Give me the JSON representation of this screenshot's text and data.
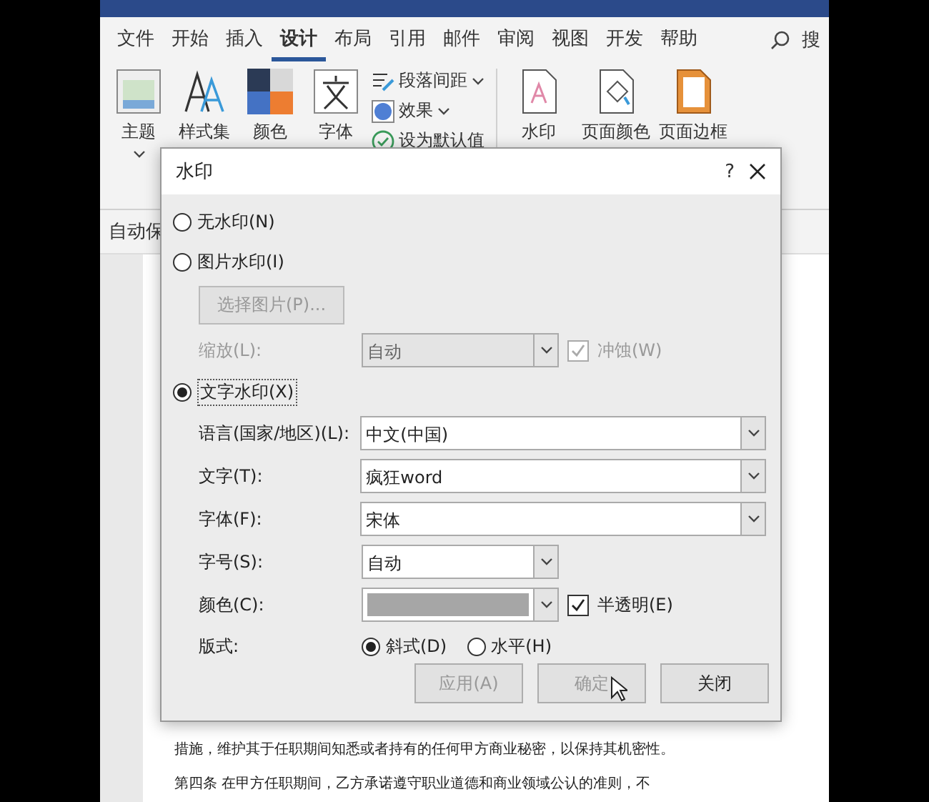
{
  "menu_tabs": [
    {
      "label": "文件",
      "selected": false
    },
    {
      "label": "开始",
      "selected": false
    },
    {
      "label": "插入",
      "selected": false
    },
    {
      "label": "设计",
      "selected": true
    },
    {
      "label": "布局",
      "selected": false
    },
    {
      "label": "引用",
      "selected": false
    },
    {
      "label": "邮件",
      "selected": false
    },
    {
      "label": "审阅",
      "selected": false
    },
    {
      "label": "视图",
      "selected": false
    },
    {
      "label": "开发",
      "selected": false
    },
    {
      "label": "帮助",
      "selected": false
    }
  ],
  "search_label": "搜",
  "ribbon": {
    "large": [
      {
        "label": "主题",
        "kind": "theme"
      },
      {
        "label": "样式集",
        "kind": "styles"
      },
      {
        "label": "颜色",
        "kind": "colors"
      },
      {
        "label": "字体",
        "kind": "fonts"
      }
    ],
    "small": [
      {
        "label": "段落间距",
        "kind": "spacing"
      },
      {
        "label": "效果",
        "kind": "effects"
      },
      {
        "label": "设为默认值",
        "kind": "default"
      }
    ],
    "page_background": [
      {
        "label": "水印",
        "kind": "watermark"
      },
      {
        "label": "页面颜色",
        "kind": "page_color"
      },
      {
        "label": "页面边框",
        "kind": "page_border"
      }
    ]
  },
  "status_strip": "自动保",
  "document": {
    "lines": [
      "措施，维护其于任职期间知悉或者持有的任何甲方商业秘密，以保持其机密性。",
      "第四条 在甲方任职期间，乙方承诺遵守职业道德和商业领域公认的准则，不"
    ]
  },
  "dialog": {
    "title": "水印",
    "help": "?",
    "no_watermark": {
      "label": "无水印(N)",
      "selected": false
    },
    "picture_watermark": {
      "label": "图片水印(I)",
      "selected": false
    },
    "select_picture": {
      "label": "选择图片(P)...",
      "disabled": true
    },
    "scale": {
      "label": "缩放(L):",
      "value": "自动",
      "disabled": true
    },
    "washout": {
      "label": "冲蚀(W)",
      "checked": true,
      "disabled": true
    },
    "text_watermark": {
      "label": "文字水印(X)",
      "selected": true
    },
    "fields": [
      {
        "label": "语言(国家/地区)(L):",
        "value": "中文(中国)",
        "kind": "wide"
      },
      {
        "label": "文字(T):",
        "value": "疯狂word",
        "kind": "wide"
      },
      {
        "label": "字体(F):",
        "value": "宋体",
        "kind": "wide"
      },
      {
        "label": "字号(S):",
        "value": "自动",
        "kind": "narrow"
      },
      {
        "label": "颜色(C):",
        "color": "#a6a6a6",
        "kind": "swatch"
      }
    ],
    "semi_transparent": {
      "label": "半透明(E)",
      "checked": true
    },
    "layout": {
      "label": "版式:",
      "options": [
        {
          "label": "斜式(D)",
          "selected": true
        },
        {
          "label": "水平(H)",
          "selected": false
        }
      ]
    },
    "buttons": [
      {
        "label": "应用(A)",
        "disabled": true
      },
      {
        "label": "确定",
        "disabled": true
      },
      {
        "label": "关闭",
        "disabled": false
      }
    ]
  }
}
